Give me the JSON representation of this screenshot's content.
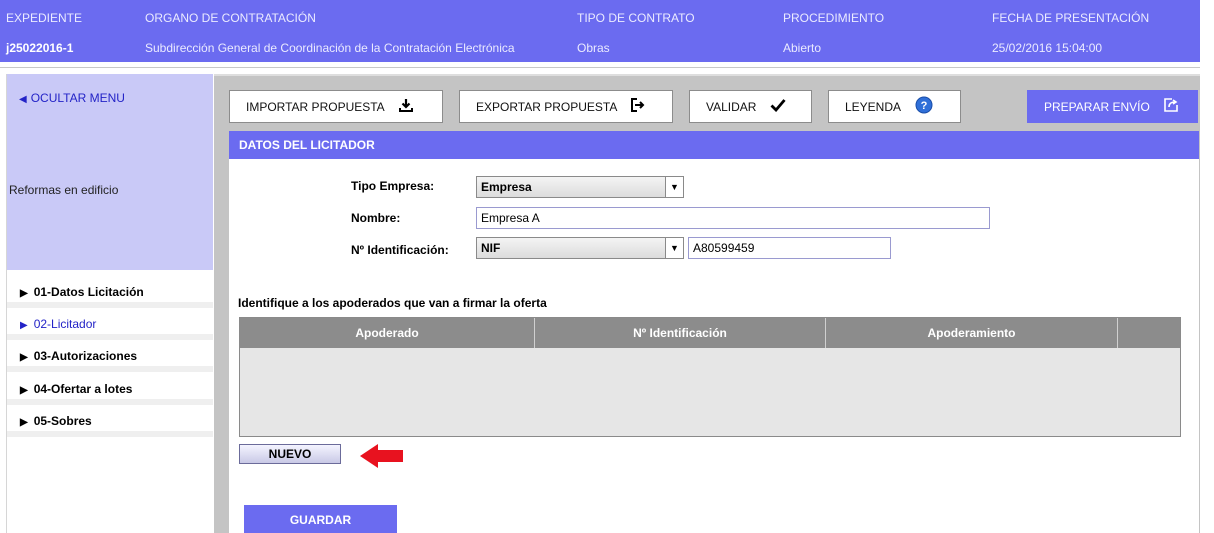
{
  "header": {
    "labels": {
      "expediente": "EXPEDIENTE",
      "organo": "ORGANO DE CONTRATACIÓN",
      "tipo": "TIPO DE CONTRATO",
      "procedimiento": "PROCEDIMIENTO",
      "fecha": "FECHA DE PRESENTACIÓN"
    },
    "values": {
      "expediente": "j25022016-1",
      "organo": "Subdirección General de Coordinación de la Contratación Electrónica",
      "tipo": "Obras",
      "procedimiento": "Abierto",
      "fecha": "25/02/2016 15:04:00"
    }
  },
  "sidebar": {
    "hide_menu": "OCULTAR MENU",
    "project_name": "Reformas en edificio",
    "items": [
      {
        "label": "01-Datos Licitación"
      },
      {
        "label": "02-Licitador"
      },
      {
        "label": "03-Autorizaciones"
      },
      {
        "label": "04-Ofertar a lotes"
      },
      {
        "label": "05-Sobres"
      }
    ],
    "active_index": 1
  },
  "toolbar": {
    "import": "IMPORTAR PROPUESTA",
    "export": "EXPORTAR PROPUESTA",
    "validate": "VALIDAR",
    "legend": "LEYENDA",
    "send": "PREPARAR ENVÍO"
  },
  "panel": {
    "title": "DATOS DEL LICITADOR",
    "tipo_empresa_label": "Tipo Empresa:",
    "tipo_empresa_value": "Empresa",
    "nombre_label": "Nombre:",
    "nombre_value": "Empresa A",
    "id_label": "Nº Identificación:",
    "id_type_value": "NIF",
    "id_value": "A80599459"
  },
  "apoderados": {
    "title": "Identifique a los apoderados que van a firmar la oferta",
    "columns": [
      "Apoderado",
      "Nº Identificación",
      "Apoderamiento",
      ""
    ]
  },
  "actions": {
    "nuevo": "NUEVO",
    "guardar": "GUARDAR"
  },
  "colors": {
    "accent": "#6b6bf0",
    "sidebar_top": "#c9c9f7",
    "arrow": "#e8121f"
  }
}
